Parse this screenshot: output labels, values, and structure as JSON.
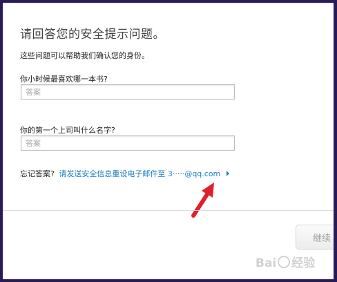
{
  "page": {
    "title": "请回答您的安全提示问题。",
    "subtitle": "这些问题可以帮助我们确认您的身份。"
  },
  "questions": [
    {
      "label": "你小时候最喜欢哪一本书?",
      "value": "",
      "placeholder": "答案"
    },
    {
      "label": "你的第一个上司叫什么名字?",
      "value": "",
      "placeholder": "答案"
    }
  ],
  "forgot": {
    "label": "忘记答案?",
    "link_text": "请发送安全信息重设电子邮件至 3·····@qq.com"
  },
  "buttons": {
    "continue_label": "继续"
  },
  "watermark": {
    "text_left": "Bai",
    "text_right": "经验"
  },
  "colors": {
    "link": "#1a7fc1",
    "annotation_arrow": "#e0202a",
    "frame": "#2a1a57"
  },
  "icons": {
    "link_arrow": "chevron-right-icon",
    "annotation": "red-arrow-icon"
  }
}
